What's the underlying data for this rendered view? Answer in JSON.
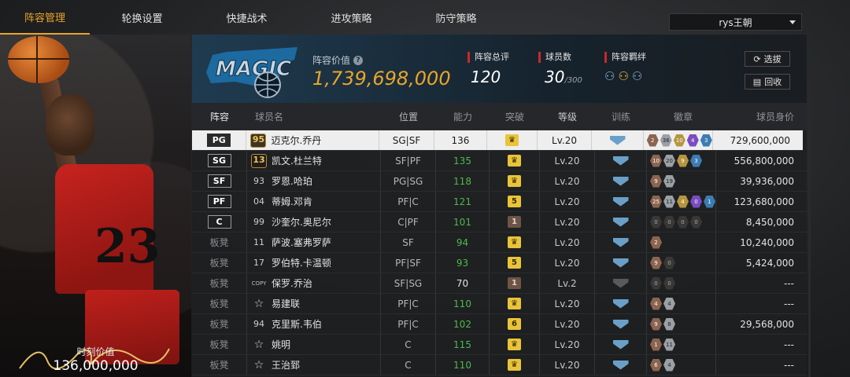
{
  "tabs": [
    {
      "label": "阵容管理",
      "active": true
    },
    {
      "label": "轮换设置",
      "active": false
    },
    {
      "label": "快捷战术",
      "active": false
    },
    {
      "label": "进攻策略",
      "active": false
    },
    {
      "label": "防守策略",
      "active": false
    }
  ],
  "team_select": {
    "value": "rys王朝"
  },
  "featured": {
    "value_label": "时刻价值",
    "value": "136,000,000",
    "jersey_number": "23"
  },
  "info": {
    "cap_label": "阵容价值",
    "cap_value": "1,739,698,000",
    "rating_label": "阵容总评",
    "rating_value": "120",
    "count_label": "球员数",
    "count_value": "30",
    "count_max": "/300",
    "bond_label": "阵容羁绊",
    "select_btn": "选拔",
    "recycle_btn": "回收"
  },
  "columns": [
    "阵容",
    "球员名",
    "位置",
    "能力",
    "突破",
    "等级",
    "训练",
    "徽章",
    "球员身价"
  ],
  "players": [
    {
      "slot": "PG",
      "tag": true,
      "rating": "95",
      "rtype": "hex",
      "name": "迈克尔.乔丹",
      "pos": "SG|SF",
      "abil": "136",
      "abilGreen": false,
      "brk": "crown",
      "brkColor": "gold",
      "lv": "Lv.20",
      "train": "blue",
      "badges": [
        [
          "2",
          "bronze"
        ],
        [
          "36",
          "silver"
        ],
        [
          "10",
          "gold"
        ],
        [
          "4",
          "purple"
        ],
        [
          "3",
          "blue"
        ]
      ],
      "value": "729,600,000",
      "selected": true
    },
    {
      "slot": "SG",
      "tag": true,
      "rating": "13",
      "rtype": "hex",
      "name": "凯文.杜兰特",
      "pos": "SF|PF",
      "abil": "135",
      "abilGreen": true,
      "brk": "crown",
      "brkColor": "gold",
      "lv": "Lv.20",
      "train": "blue",
      "badges": [
        [
          "10",
          "bronze"
        ],
        [
          "20",
          "silver"
        ],
        [
          "9",
          "gold"
        ],
        [
          "3",
          "blue"
        ]
      ],
      "value": "556,800,000",
      "selected": false
    },
    {
      "slot": "SF",
      "tag": true,
      "rating": "93",
      "rtype": "num",
      "name": "罗恩.哈珀",
      "pos": "PG|SG",
      "abil": "118",
      "abilGreen": true,
      "brk": "crown",
      "brkColor": "gold",
      "lv": "Lv.20",
      "train": "blue",
      "badges": [
        [
          "9",
          "bronze"
        ],
        [
          "19",
          "silver"
        ]
      ],
      "value": "39,936,000",
      "selected": false
    },
    {
      "slot": "PF",
      "tag": true,
      "rating": "04",
      "rtype": "num",
      "name": "蒂姆.邓肯",
      "pos": "PF|C",
      "abil": "121",
      "abilGreen": true,
      "brk": "5",
      "brkColor": "gold",
      "lv": "Lv.20",
      "train": "blue",
      "badges": [
        [
          "25",
          "bronze"
        ],
        [
          "11",
          "silver"
        ],
        [
          "4",
          "gold"
        ],
        [
          "0",
          "purple"
        ],
        [
          "1",
          "blue"
        ]
      ],
      "value": "123,680,000",
      "selected": false
    },
    {
      "slot": "C",
      "tag": true,
      "rating": "99",
      "rtype": "num",
      "name": "沙奎尔.奥尼尔",
      "pos": "C|PF",
      "abil": "101",
      "abilGreen": true,
      "brk": "1",
      "brkColor": "brown",
      "lv": "Lv.20",
      "train": "blue",
      "badges": [
        [
          "0",
          "dark"
        ],
        [
          "0",
          "dark"
        ],
        [
          "0",
          "dark"
        ],
        [
          "0",
          "dark"
        ]
      ],
      "value": "8,450,000",
      "selected": false
    },
    {
      "slot": "板凳",
      "tag": false,
      "rating": "11",
      "rtype": "num",
      "name": "萨波.塞弗罗萨",
      "pos": "SF",
      "abil": "94",
      "abilGreen": true,
      "brk": "crown",
      "brkColor": "gold",
      "lv": "Lv.20",
      "train": "blue",
      "badges": [
        [
          "2",
          "bronze"
        ]
      ],
      "value": "10,240,000",
      "selected": false
    },
    {
      "slot": "板凳",
      "tag": false,
      "rating": "17",
      "rtype": "num",
      "name": "罗伯特.卡温顿",
      "pos": "PF|SF",
      "abil": "93",
      "abilGreen": true,
      "brk": "5",
      "brkColor": "gold",
      "lv": "Lv.20",
      "train": "blue",
      "badges": [
        [
          "9",
          "bronze"
        ],
        [
          "0",
          "dark"
        ]
      ],
      "value": "5,424,000",
      "selected": false
    },
    {
      "slot": "板凳",
      "tag": false,
      "rating": "COPY",
      "rtype": "copy",
      "name": "保罗.乔治",
      "pos": "SF|SG",
      "abil": "70",
      "abilGreen": false,
      "brk": "1",
      "brkColor": "brown",
      "lv": "Lv.2",
      "train": "grey",
      "badges": [
        [
          "0",
          "dark"
        ],
        [
          "0",
          "dark"
        ]
      ],
      "value": "---",
      "selected": false
    },
    {
      "slot": "板凳",
      "tag": false,
      "rating": "☆",
      "rtype": "star",
      "name": "易建联",
      "pos": "PF|C",
      "abil": "110",
      "abilGreen": true,
      "brk": "crown",
      "brkColor": "gold",
      "lv": "Lv.20",
      "train": "blue",
      "badges": [
        [
          "4",
          "bronze"
        ],
        [
          "4",
          "silver"
        ]
      ],
      "value": "---",
      "selected": false
    },
    {
      "slot": "板凳",
      "tag": false,
      "rating": "94",
      "rtype": "num",
      "name": "克里斯.韦伯",
      "pos": "PF|C",
      "abil": "102",
      "abilGreen": true,
      "brk": "6",
      "brkColor": "gold",
      "lv": "Lv.20",
      "train": "blue",
      "badges": [
        [
          "9",
          "bronze"
        ],
        [
          "8",
          "silver"
        ]
      ],
      "value": "29,568,000",
      "selected": false
    },
    {
      "slot": "板凳",
      "tag": false,
      "rating": "☆",
      "rtype": "star",
      "name": "姚明",
      "pos": "C",
      "abil": "115",
      "abilGreen": true,
      "brk": "crown",
      "brkColor": "gold",
      "lv": "Lv.20",
      "train": "blue",
      "badges": [
        [
          "1",
          "bronze"
        ],
        [
          "11",
          "silver"
        ]
      ],
      "value": "---",
      "selected": false
    },
    {
      "slot": "板凳",
      "tag": false,
      "rating": "☆",
      "rtype": "star",
      "name": "王治郅",
      "pos": "C",
      "abil": "110",
      "abilGreen": true,
      "brk": "crown",
      "brkColor": "gold",
      "lv": "Lv.20",
      "train": "blue",
      "badges": [
        [
          "6",
          "bronze"
        ],
        [
          "4",
          "silver"
        ]
      ],
      "value": "---",
      "selected": false
    }
  ]
}
